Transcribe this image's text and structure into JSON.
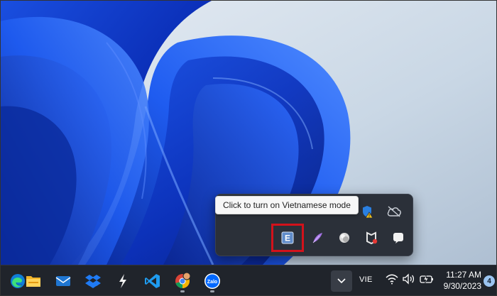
{
  "tooltip": {
    "text": "Click to turn on Vietnamese mode"
  },
  "tray_overflow": {
    "top_row_icons": [
      "windows-security-warning-icon",
      "cloud-offline-icon"
    ],
    "bottom_row_icons": [
      "unikey-e-icon",
      "feather-app-icon",
      "globe-ball-icon",
      "mcafee-icon",
      "chat-bubble-icon"
    ],
    "highlighted_icon": "unikey-e-icon",
    "highlight_color": "#d3121b"
  },
  "taskbar": {
    "apps": [
      "edge-icon",
      "file-explorer-icon",
      "mail-icon",
      "dropbox-icon",
      "sharex-icon",
      "vscode-icon",
      "chrome-icon",
      "zalo-icon"
    ],
    "zalo_label": "Zalo",
    "language": "VIE",
    "time": "11:27 AM",
    "date": "9/30/2023",
    "notification_count": "4"
  },
  "colors": {
    "accent_blue": "#1e66ff",
    "taskbar_bg": "#20242b",
    "flyout_bg": "#2b3039"
  }
}
